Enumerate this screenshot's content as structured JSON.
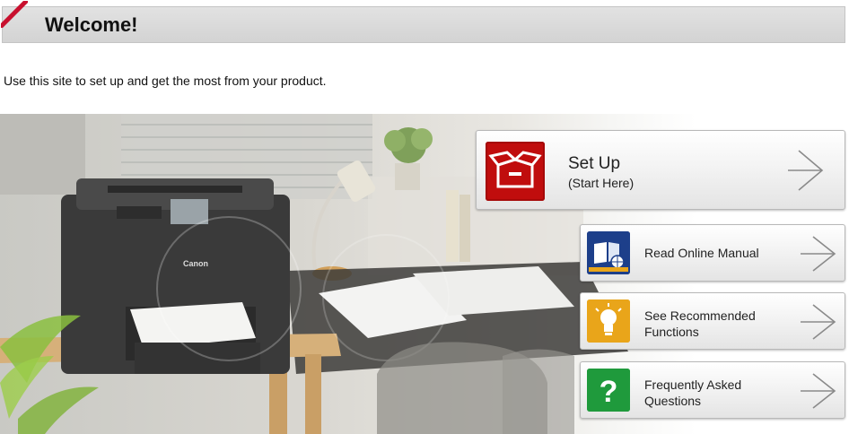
{
  "header": {
    "title": "Welcome!"
  },
  "intro": {
    "text": "Use this site to set up and get the most from your product."
  },
  "printer": {
    "brand": "Canon"
  },
  "menu": {
    "setup": {
      "label": "Set Up",
      "sublabel": "(Start Here)",
      "icon": "box-icon"
    },
    "manual": {
      "label": "Read Online Manual",
      "icon": "online-manual-icon"
    },
    "recommend": {
      "label_line1": "See Recommended",
      "label_line2": "Functions",
      "icon": "lightbulb-icon"
    },
    "faq": {
      "label_line1": "Frequently Asked",
      "label_line2": "Questions",
      "icon": "question-mark-icon"
    }
  },
  "colors": {
    "accent_red": "#c00d0d",
    "manual_blue": "#1d3f8a",
    "tip_yellow": "#e9a51a",
    "faq_green": "#1f9a3c"
  }
}
